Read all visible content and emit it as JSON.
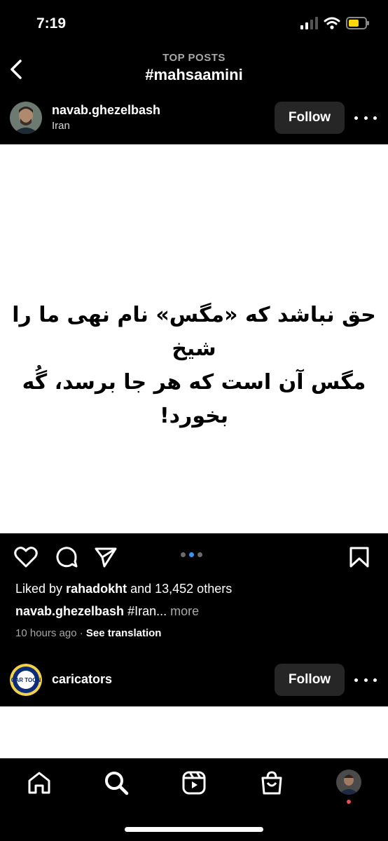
{
  "status_bar": {
    "time": "7:19"
  },
  "header": {
    "kicker": "TOP POSTS",
    "title": "#mahsaamini"
  },
  "post1": {
    "username": "navab.ghezelbash",
    "location": "Iran",
    "follow_label": "Follow",
    "image_text": [
      "حق نباشد که «مگس» نام نهی ما را شیخ",
      "مگس آن است که هر جا برسد، گُه بخورد!"
    ],
    "carousel": {
      "count": 3,
      "active": 2
    },
    "likes": {
      "prefix": "Liked by",
      "user": "rahadokht",
      "suffix": "and 13,452 others"
    },
    "caption": {
      "user": "navab.ghezelbash",
      "text": "#Iran...",
      "more": "more"
    },
    "time_ago": "10 hours ago",
    "separator": "·",
    "translation_label": "See translation"
  },
  "post2": {
    "username": "caricators",
    "follow_label": "Follow",
    "avatar_text": "CAR TOON"
  },
  "icons": {
    "back": "chevron-left-icon",
    "like": "heart-icon",
    "comment": "comment-icon",
    "share": "send-icon",
    "save": "bookmark-icon",
    "tabs": [
      "home-icon",
      "search-icon",
      "reels-icon",
      "shop-icon",
      "profile-icon"
    ]
  },
  "colors": {
    "background": "#000000",
    "button": "#262626",
    "accent_dot": "#3797f0",
    "notify": "#ed4956"
  }
}
